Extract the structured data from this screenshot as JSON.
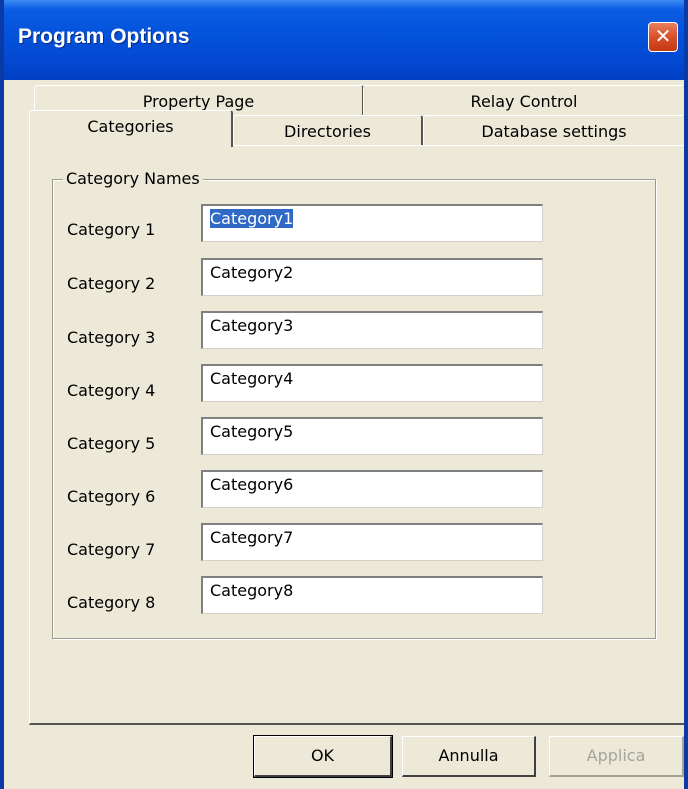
{
  "window": {
    "title": "Program Options",
    "close_glyph": "✕",
    "close_icon": "close-icon"
  },
  "tabs": {
    "back_row": [
      {
        "label": "Property Page"
      },
      {
        "label": "Relay Control"
      }
    ],
    "front_row": [
      {
        "label": "Categories",
        "active": true
      },
      {
        "label": "Directories"
      },
      {
        "label": "Database settings"
      }
    ]
  },
  "group": {
    "legend": "Category Names",
    "fields": [
      {
        "label": "Category 1",
        "value": "Category1",
        "selected": true
      },
      {
        "label": "Category 2",
        "value": "Category2"
      },
      {
        "label": "Category 3",
        "value": "Category3"
      },
      {
        "label": "Category 4",
        "value": "Category4"
      },
      {
        "label": "Category 5",
        "value": "Category5"
      },
      {
        "label": "Category 6",
        "value": "Category6"
      },
      {
        "label": "Category 7",
        "value": "Category7"
      },
      {
        "label": "Category 8",
        "value": "Category8"
      }
    ]
  },
  "buttons": {
    "ok": "OK",
    "cancel": "Annulla",
    "apply": "Applica"
  },
  "colors": {
    "titlebar": "#0553dc",
    "face": "#ece9d8",
    "close": "#d9502a",
    "selection": "#316ac5"
  }
}
